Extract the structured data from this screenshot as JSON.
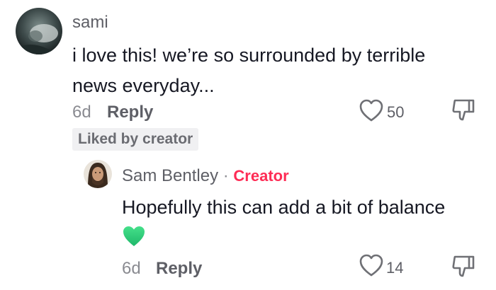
{
  "comment": {
    "username": "sami",
    "text_line1": "i love this! we’re so surrounded by terrible",
    "text_line2": "news everyday...",
    "time": "6d",
    "reply_label": "Reply",
    "likes": "50",
    "liked_badge": "Liked by creator"
  },
  "reply_comment": {
    "username": "Sam Bentley",
    "separator": "·",
    "creator_tag": "Creator",
    "text": "Hopefully this can add a bit of balance",
    "emoji": "green-heart-emoji",
    "time": "6d",
    "reply_label": "Reply",
    "likes": "14"
  },
  "icons": {
    "like": "heart-outline-icon",
    "dislike": "thumbs-down-outline-icon"
  },
  "colors": {
    "creator_accent": "#fe2c55",
    "emoji_green": "#2ecc71"
  }
}
